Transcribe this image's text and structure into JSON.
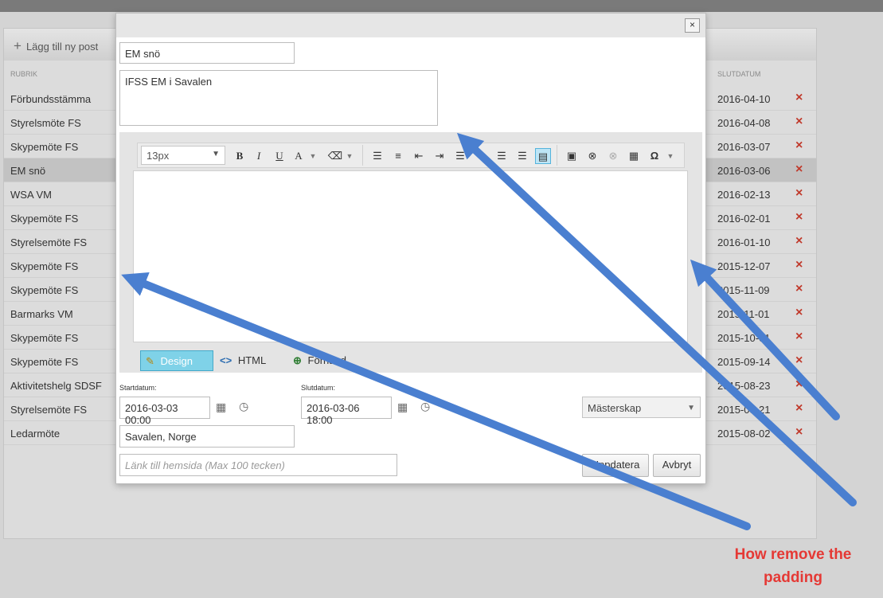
{
  "list": {
    "add_label": "Lägg till ny post",
    "header_title": "RUBRIK",
    "header_end": "SLUTDATUM",
    "delete_icon": "×",
    "rows": [
      {
        "title": "Förbundsstämma",
        "end": "2016-04-10"
      },
      {
        "title": "Styrelsmöte FS",
        "end": "2016-04-08"
      },
      {
        "title": "Skypemöte FS",
        "end": "2016-03-07"
      },
      {
        "title": "EM snö",
        "end": "2016-03-06"
      },
      {
        "title": "WSA VM",
        "end": "2016-02-13"
      },
      {
        "title": "Skypemöte FS",
        "end": "2016-02-01"
      },
      {
        "title": "Styrelsemöte FS",
        "end": "2016-01-10"
      },
      {
        "title": "Skypemöte FS",
        "end": "2015-12-07"
      },
      {
        "title": "Skypemöte FS",
        "end": "2015-11-09"
      },
      {
        "title": "Barmarks VM",
        "end": "2015-11-01"
      },
      {
        "title": "Skypemöte FS",
        "end": "2015-10-01"
      },
      {
        "title": "Skypemöte FS",
        "end": "2015-09-14"
      },
      {
        "title": "Aktivitetshelg SDSF",
        "end": "2015-08-23"
      },
      {
        "title": "Styrelsemöte FS",
        "end": "2015-08-21"
      },
      {
        "title": "Ledarmöte",
        "end": "2015-08-02"
      }
    ],
    "selected_row": 3
  },
  "modal": {
    "close_label": "×",
    "title_value": "EM snö",
    "summary_value": "IFSS EM i Savalen",
    "editor": {
      "font_size": "13px",
      "tabs": {
        "design": "Design",
        "html": "HTML",
        "preview": "Förhand"
      }
    },
    "start_label": "Startdatum:",
    "start_value": "2016-03-03 00:00",
    "end_label": "Slutdatum:",
    "end_value": "2016-03-06 18:00",
    "category_value": "Mästerskap",
    "location_value": "Savalen, Norge",
    "link_placeholder": "Länk till hemsida (Max 100 tecken)",
    "update_label": "Uppdatera",
    "cancel_label": "Avbryt"
  },
  "annotation": {
    "text": "How remove the padding",
    "color": "#e53935",
    "arrow_color": "#4a7fd0"
  }
}
